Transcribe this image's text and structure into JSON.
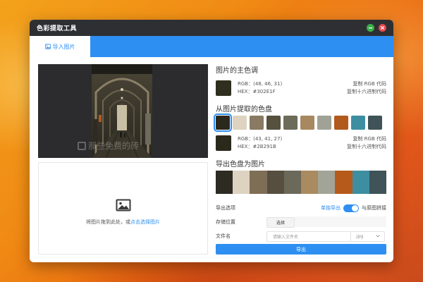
{
  "window": {
    "title": "色彩提取工具"
  },
  "tabs": [
    {
      "label": "导入图片",
      "active": true
    }
  ],
  "preview": {
    "watermark": "那些免费的砖"
  },
  "dropzone": {
    "hint_prefix": "将图片拖到此处，或",
    "hint_link": "点击选择图片"
  },
  "main_color": {
    "title": "图片的主色调",
    "rgb": "RGB：(48, 46, 31)",
    "hex": "HEX：#302E1F",
    "color": "#302E1F",
    "copy_rgb": "复制 RGB 代码",
    "copy_hex": "复制十六进制代码"
  },
  "palette": {
    "title": "从图片提取的色盘",
    "colors": [
      "#2B291B",
      "#DDD3C0",
      "#8A7A63",
      "#56503F",
      "#6D6C5A",
      "#A88860",
      "#A0A295",
      "#B25A1E",
      "#3D8EA0",
      "#3F5358"
    ],
    "selected_index": 0
  },
  "selected_color": {
    "rgb": "RGB：(43, 41, 27)",
    "hex": "HEX：#2B291B",
    "color": "#2B291B",
    "copy_rgb": "复制 RGB 代码",
    "copy_hex": "复制十六进制代码"
  },
  "export": {
    "title": "导出色盘为图片",
    "strip_colors": [
      "#2E2B22",
      "#DDD3C0",
      "#7E6E55",
      "#564E3F",
      "#6A695A",
      "#AA8A60",
      "#A3A498",
      "#B65A1C",
      "#3D8EA0",
      "#3F5358"
    ],
    "options_label": "导出选项",
    "single_label": "单独导出",
    "merge_label": "与原图拼接",
    "toggle_on": true,
    "location_label": "存储位置",
    "choose_label": "选择",
    "filename_label": "文件名",
    "filename_placeholder": "请输入文件名",
    "extension": ".jpg",
    "export_button": "导出"
  }
}
